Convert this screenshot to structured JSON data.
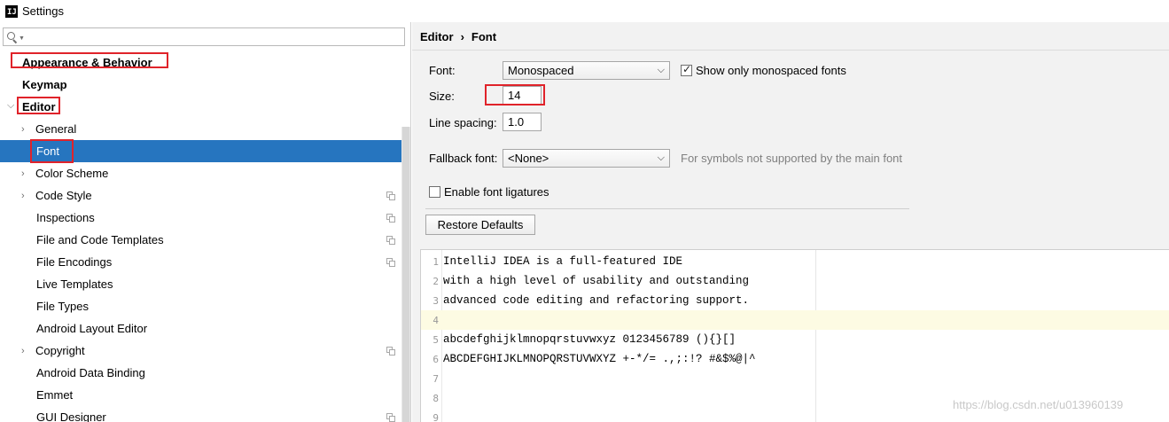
{
  "window": {
    "title": "Settings"
  },
  "search": {
    "value": "",
    "placeholder": ""
  },
  "tree": {
    "items": [
      {
        "label": "Appearance & Behavior",
        "bold": true,
        "expander": ""
      },
      {
        "label": "Keymap",
        "bold": true,
        "expander": ""
      },
      {
        "label": "Editor",
        "bold": true,
        "expander": "expanded"
      },
      {
        "label": "General",
        "bold": false,
        "expander": "collapsed"
      },
      {
        "label": "Font",
        "bold": false,
        "expander": "",
        "selected": true
      },
      {
        "label": "Color Scheme",
        "bold": false,
        "expander": "collapsed"
      },
      {
        "label": "Code Style",
        "bold": false,
        "expander": "collapsed",
        "project_icon": true
      },
      {
        "label": "Inspections",
        "bold": false,
        "expander": "",
        "project_icon": true
      },
      {
        "label": "File and Code Templates",
        "bold": false,
        "expander": "",
        "project_icon": true
      },
      {
        "label": "File Encodings",
        "bold": false,
        "expander": "",
        "project_icon": true
      },
      {
        "label": "Live Templates",
        "bold": false,
        "expander": ""
      },
      {
        "label": "File Types",
        "bold": false,
        "expander": ""
      },
      {
        "label": "Android Layout Editor",
        "bold": false,
        "expander": ""
      },
      {
        "label": "Copyright",
        "bold": false,
        "expander": "collapsed",
        "project_icon": true
      },
      {
        "label": "Android Data Binding",
        "bold": false,
        "expander": ""
      },
      {
        "label": "Emmet",
        "bold": false,
        "expander": ""
      },
      {
        "label": "GUI Designer",
        "bold": false,
        "expander": "",
        "project_icon": true
      }
    ]
  },
  "breadcrumb": {
    "parent": "Editor",
    "separator": "›",
    "current": "Font"
  },
  "font_settings": {
    "font_label": "Font:",
    "font_value": "Monospaced",
    "show_monospaced_label": "Show only monospaced fonts",
    "show_monospaced_checked": true,
    "size_label": "Size:",
    "size_value": "14",
    "line_spacing_label": "Line spacing:",
    "line_spacing_value": "1.0",
    "fallback_label": "Fallback font:",
    "fallback_value": "<None>",
    "fallback_hint": "For symbols not supported by the main font",
    "ligatures_label": "Enable font ligatures",
    "ligatures_checked": false,
    "restore_label": "Restore Defaults"
  },
  "preview": {
    "lines": [
      {
        "num": "1",
        "text": "IntelliJ IDEA is a full-featured IDE"
      },
      {
        "num": "2",
        "text": "with a high level of usability and outstanding"
      },
      {
        "num": "3",
        "text": "advanced code editing and refactoring support."
      },
      {
        "num": "4",
        "text": ""
      },
      {
        "num": "5",
        "text": "abcdefghijklmnopqrstuvwxyz 0123456789 (){}[]"
      },
      {
        "num": "6",
        "text": "ABCDEFGHIJKLMNOPQRSTUVWXYZ +-*/= .,;:!? #&$%@|^"
      },
      {
        "num": "7",
        "text": ""
      },
      {
        "num": "8",
        "text": ""
      },
      {
        "num": "9",
        "text": ""
      }
    ],
    "current_line": "4"
  },
  "watermark": "https://blog.csdn.net/u013960139",
  "colors": {
    "selection": "#2675bf",
    "highlight_box": "#e0232a",
    "current_line": "#fdfbe3"
  },
  "icons": {
    "app": "intellij-icon",
    "search": "search-icon",
    "expand": "chevron-down-icon",
    "collapse": "chevron-right-icon",
    "project": "copy-icon"
  }
}
